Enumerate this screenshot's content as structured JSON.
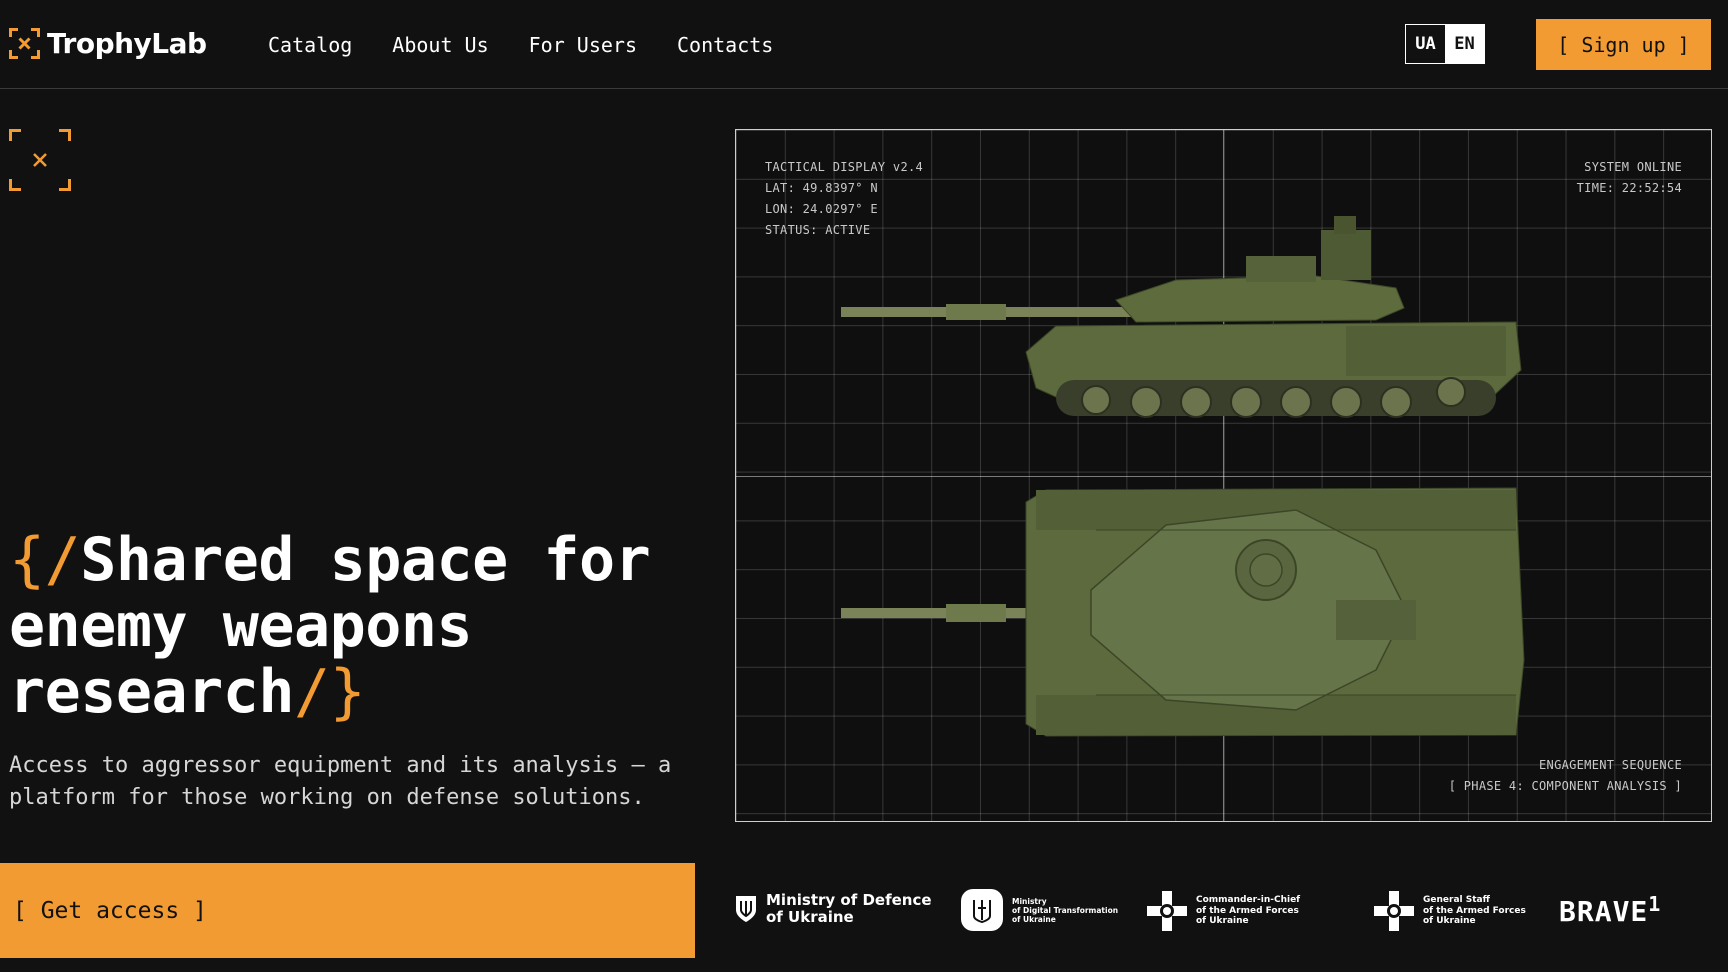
{
  "brand": {
    "name": "TrophyLab",
    "accent_color": "#f29b32",
    "background_color": "#111111"
  },
  "nav": {
    "items": [
      {
        "label": "Catalog"
      },
      {
        "label": "About Us"
      },
      {
        "label": "For Users"
      },
      {
        "label": "Contacts"
      }
    ]
  },
  "lang": {
    "ua": "UA",
    "en": "EN",
    "selected": "EN"
  },
  "header": {
    "signup_label": "[ Sign up ]"
  },
  "hero": {
    "title_open": "{/",
    "title_text": "Shared space for enemy weapons research",
    "title_close": "/}",
    "subtitle": "Access to aggressor equipment and its analysis — a platform for those working on defense solutions.",
    "cta_label": "[ Get access ]",
    "corner_icon": "target-frame-icon"
  },
  "display": {
    "title": "TACTICAL DISPLAY v2.4",
    "lat": "LAT: 49.8397° N",
    "lon": "LON: 24.0297° E",
    "status": "STATUS: ACTIVE",
    "system": "SYSTEM ONLINE",
    "time": "TIME: 22:52:54",
    "sequence": "ENGAGEMENT SEQUENCE",
    "phase": "[ PHASE 4: COMPONENT ANALYSIS ]",
    "tank_color": "#5c6a3e"
  },
  "partners": {
    "mod_line1": "Ministry of Defence",
    "mod_line2": "of Ukraine",
    "digital_line1": "Ministry",
    "digital_line2": "of Digital Transformation",
    "digital_line3": "of Ukraine",
    "cinc_line1": "Commander-in-Chief",
    "cinc_line2": "of the Armed Forces",
    "cinc_line3": "of Ukraine",
    "gs_line1": "General Staff",
    "gs_line2": "of the Armed Forces",
    "gs_line3": "of Ukraine",
    "brave_text": "BRAVE",
    "brave_sup": "1"
  }
}
